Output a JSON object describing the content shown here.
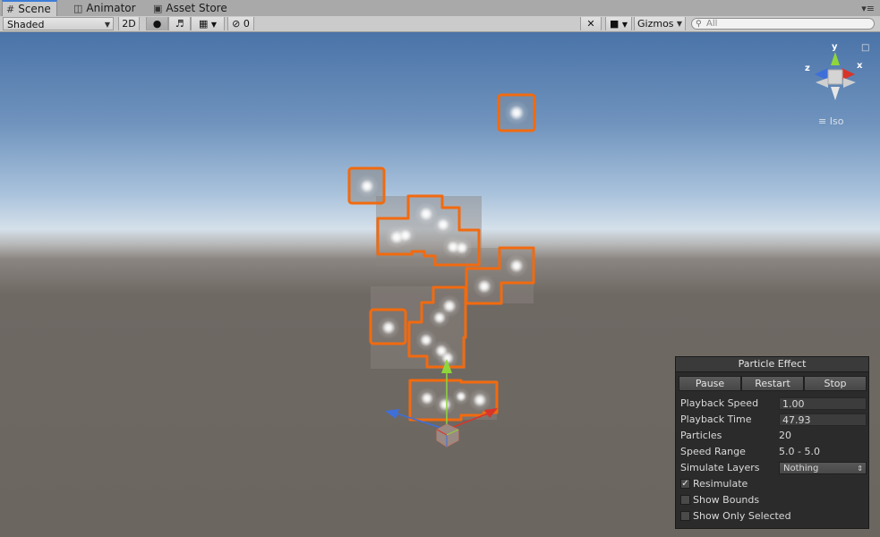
{
  "tabs": [
    {
      "label": "Scene",
      "icon": "grid-icon",
      "active": true
    },
    {
      "label": "Animator",
      "icon": "animator-icon",
      "active": false
    },
    {
      "label": "Asset Store",
      "icon": "store-icon",
      "active": false
    }
  ],
  "toolbar": {
    "draw_mode": "Shaded",
    "mode_2d": "2D",
    "hidden_count": "0",
    "gizmos": "Gizmos",
    "search_placeholder": "All"
  },
  "gizmo": {
    "axis_y": "y",
    "axis_x": "x",
    "axis_z": "z",
    "projection": "Iso"
  },
  "particle_panel": {
    "title": "Particle Effect",
    "buttons": {
      "pause": "Pause",
      "restart": "Restart",
      "stop": "Stop"
    },
    "playback_speed_label": "Playback Speed",
    "playback_speed": "1.00",
    "playback_time_label": "Playback Time",
    "playback_time": "47.93",
    "particles_label": "Particles",
    "particles": "20",
    "speed_range_label": "Speed Range",
    "speed_range": "5.0 - 5.0",
    "simulate_layers_label": "Simulate Layers",
    "simulate_layers": "Nothing",
    "resimulate_label": "Resimulate",
    "resimulate_checked": true,
    "show_bounds_label": "Show Bounds",
    "show_bounds_checked": false,
    "show_only_selected_label": "Show Only Selected",
    "show_only_selected_checked": false
  },
  "colors": {
    "selection_outline": "#f26a0f",
    "axis_x": "#d8352a",
    "axis_y": "#8fd63a",
    "axis_z": "#3f6fd8",
    "panel_bg": "#2b2b2b"
  }
}
